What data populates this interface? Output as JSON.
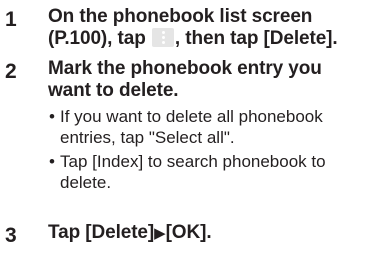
{
  "steps": [
    {
      "number": "1",
      "title_part1": "On the phonebook list screen (P.100), tap ",
      "menu_icon": "menu-dots-icon",
      "title_part2": ", then tap [Delete]."
    },
    {
      "number": "2",
      "title": "Mark the phonebook entry you want to delete.",
      "bullets": [
        "If you want to delete all phonebook entries, tap \"Select all\".",
        "Tap [Index] to search phonebook to delete."
      ]
    },
    {
      "number": "3",
      "title_part1": "Tap [Delete]",
      "arrow": "▶",
      "title_part2": "[OK]."
    }
  ],
  "colors": {
    "text": "#231f20",
    "menu_key_bg": "#e5e5e5"
  }
}
